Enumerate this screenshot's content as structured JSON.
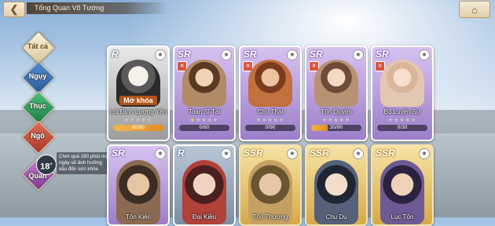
{
  "header": {
    "back_icon": "back-arrow-icon",
    "title": "Tổng Quan Võ Tướng",
    "home_icon": "home-icon"
  },
  "factions": [
    {
      "key": "all",
      "label": "Tất cả"
    },
    {
      "key": "wei",
      "label": "Ngụy"
    },
    {
      "key": "shu",
      "label": "Thục"
    },
    {
      "key": "wu",
      "label": "Ngô"
    },
    {
      "key": "qun",
      "label": "Quần"
    }
  ],
  "age_rating": {
    "value": "18",
    "suffix": "+",
    "notice": "Chơi quá 180 phút một ngày sẽ ảnh hưởng xấu đến sức khỏe"
  },
  "cards_top": [
    {
      "rarity": "R",
      "name": "Lôi Đình Lượng Yên",
      "locked": true,
      "unlock_label": "Mở khóa",
      "stars": 0,
      "progress_text": "80/80",
      "progress": 1.0
    },
    {
      "rarity": "SR",
      "name": "Toàn Sĩ Tài",
      "locked": false,
      "stars": 5,
      "progress_text": "0/60",
      "progress": 0.0
    },
    {
      "rarity": "SR",
      "name": "Chu Thái",
      "locked": false,
      "stars": 5,
      "progress_text": "0/90",
      "progress": 0.0
    },
    {
      "rarity": "SR",
      "name": "Tôn Quyền",
      "locked": false,
      "stars": 5,
      "progress_text": "30/90",
      "progress": 0.33
    },
    {
      "rarity": "SR",
      "name": "Bộ Luyện Sư",
      "locked": false,
      "stars": 5,
      "progress_text": "0/30",
      "progress": 0.0
    }
  ],
  "cards_bottom": [
    {
      "rarity": "SR",
      "name": "Tôn Kiên"
    },
    {
      "rarity": "R",
      "name": "Đại Kiều"
    },
    {
      "rarity": "SSR",
      "name": "Tôn Thượng"
    },
    {
      "rarity": "SSR",
      "name": "Chu Du"
    },
    {
      "rarity": "SSR",
      "name": "Lục Tốn"
    }
  ]
}
